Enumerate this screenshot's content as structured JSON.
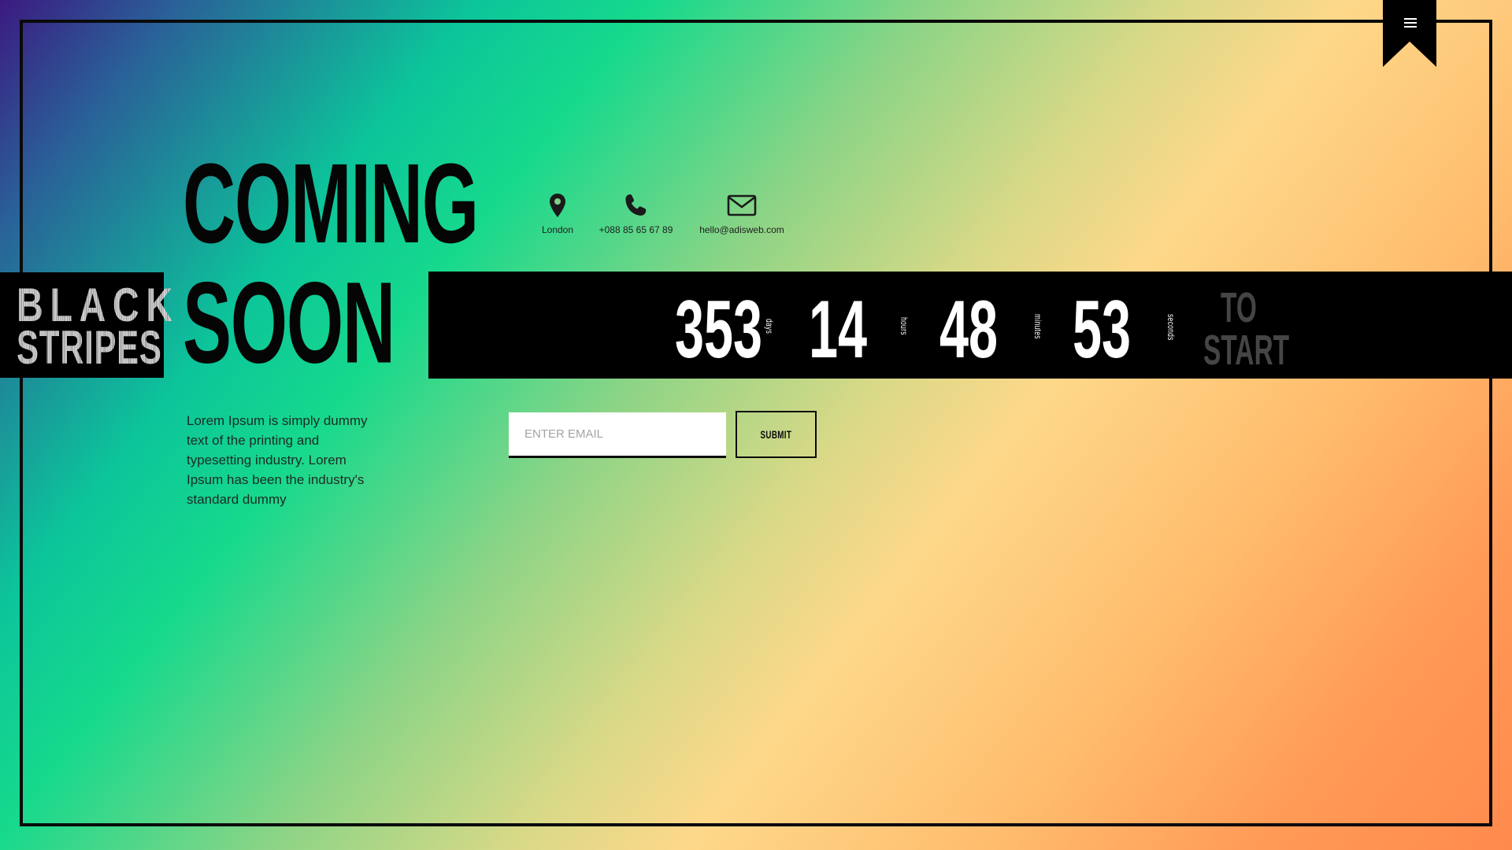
{
  "page": {
    "title_line1": "COMING",
    "title_line2": "SOON"
  },
  "logo": {
    "line1": "BLACK",
    "line2": "STRIPES"
  },
  "menu": {
    "icon": "hamburger-menu-icon"
  },
  "contacts": [
    {
      "icon": "map-pin-icon",
      "label": "London"
    },
    {
      "icon": "phone-icon",
      "label": "+088 85 65 67 89"
    },
    {
      "icon": "envelope-icon",
      "label": "hello@adisweb.com"
    }
  ],
  "countdown": {
    "days": {
      "value": "353",
      "unit": "days"
    },
    "hours": {
      "value": "14",
      "unit": "hours"
    },
    "minutes": {
      "value": "48",
      "unit": "minutes"
    },
    "seconds": {
      "value": "53",
      "unit": "seconds"
    },
    "suffix_line1": "TO",
    "suffix_line2": "START"
  },
  "description": "Lorem Ipsum is simply dummy text of the printing and typesetting industry. Lorem Ipsum has been the industry's standard dummy",
  "subscribe": {
    "placeholder": "ENTER EMAIL",
    "value": "",
    "button_label": "SUBMIT"
  },
  "colors": {
    "bar": "#000000",
    "frame": "#0a0a0a",
    "gradient_start": "#3b1a80",
    "gradient_mid_green": "#16d98c",
    "gradient_mid_yellow": "#fed88a",
    "gradient_end": "#ff8a4d"
  }
}
